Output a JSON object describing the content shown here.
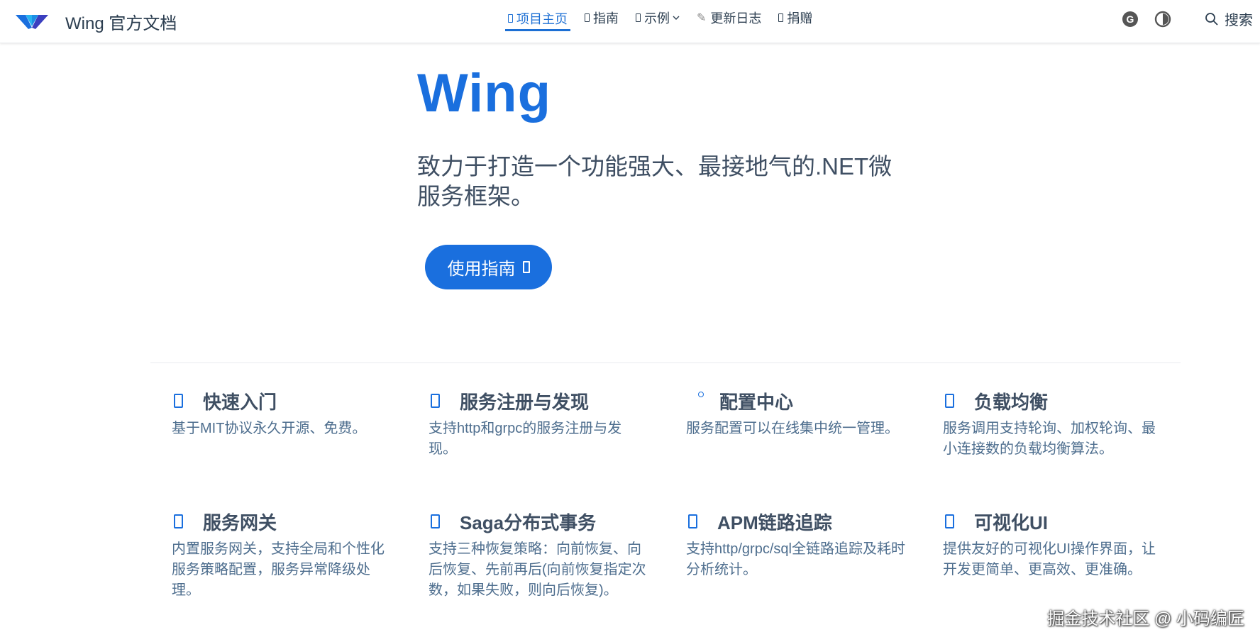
{
  "navbar": {
    "site_name": "Wing 官方文档",
    "links": [
      {
        "label": "项目主页",
        "active": true
      },
      {
        "label": "指南",
        "active": false
      },
      {
        "label": "示例",
        "active": false,
        "dropdown": true
      },
      {
        "label": "更新日志",
        "active": false
      },
      {
        "label": "捐赠",
        "active": false
      }
    ],
    "search_label": "搜索",
    "icons": [
      "wing-logo-icon",
      "github-icon",
      "theme-toggle-icon",
      "search-icon"
    ]
  },
  "hero": {
    "title": "Wing",
    "tagline": "致力于打造一个功能强大、最接地气的.NET微服务框架。",
    "action_label": "使用指南"
  },
  "features": [
    {
      "title": "快速入门",
      "desc": "基于MIT协议永久开源、免费。"
    },
    {
      "title": "服务注册与发现",
      "desc": "支持http和grpc的服务注册与发现。"
    },
    {
      "title": "配置中心",
      "desc": "服务配置可以在线集中统一管理。"
    },
    {
      "title": "负载均衡",
      "desc": "服务调用支持轮询、加权轮询、最小连接数的负载均衡算法。"
    },
    {
      "title": "服务网关",
      "desc": "内置服务网关，支持全局和个性化服务策略配置，服务异常降级处理。"
    },
    {
      "title": "Saga分布式事务",
      "desc": "支持三种恢复策略：向前恢复、向后恢复、先前再后(向前恢复指定次数，如果失败，则向后恢复)。"
    },
    {
      "title": "APM链路追踪",
      "desc": "支持http/grpc/sql全链路追踪及耗时分析统计。"
    },
    {
      "title": "可视化UI",
      "desc": "提供友好的可视化UI操作界面，让开发更简单、更高效、更准确。"
    }
  ],
  "watermark": "掘金技术社区 @ 小码编匠",
  "colors": {
    "accent": "#1a6fde",
    "text": "#2c3e50",
    "desc": "#4e6e8e"
  }
}
